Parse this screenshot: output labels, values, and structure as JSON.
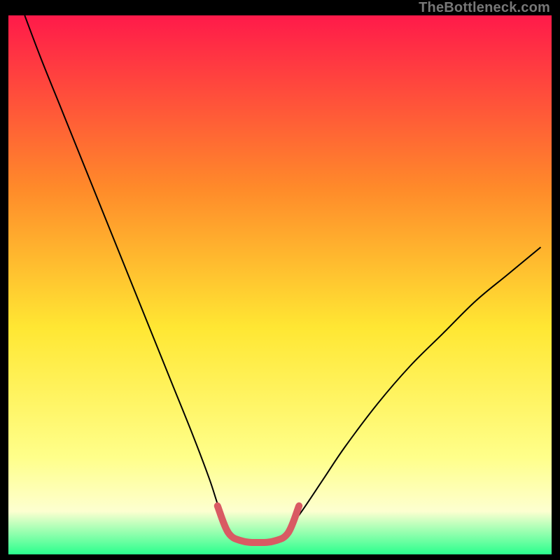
{
  "watermark": "TheBottleneck.com",
  "chart_data": {
    "type": "line",
    "title": "",
    "xlabel": "",
    "ylabel": "",
    "xlim": [
      0,
      100
    ],
    "ylim": [
      0,
      100
    ],
    "grid": false,
    "background_gradient": {
      "top": "#ff1a4a",
      "mid_upper": "#ff8a2a",
      "mid": "#ffe733",
      "mid_lower": "#ffff8a",
      "band_light": "#fdffd0",
      "bottom": "#2aff8d"
    },
    "series": [
      {
        "name": "bottleneck-curve",
        "color": "#000000",
        "stroke_width": 2,
        "points": [
          {
            "x": 3,
            "y": 100
          },
          {
            "x": 6,
            "y": 92
          },
          {
            "x": 10,
            "y": 82
          },
          {
            "x": 14,
            "y": 72
          },
          {
            "x": 18,
            "y": 62
          },
          {
            "x": 22,
            "y": 52
          },
          {
            "x": 26,
            "y": 42
          },
          {
            "x": 30,
            "y": 32
          },
          {
            "x": 34,
            "y": 22
          },
          {
            "x": 37,
            "y": 14
          },
          {
            "x": 39,
            "y": 8
          },
          {
            "x": 41,
            "y": 4
          },
          {
            "x": 43,
            "y": 2
          },
          {
            "x": 46,
            "y": 2
          },
          {
            "x": 49,
            "y": 2
          },
          {
            "x": 51,
            "y": 4
          },
          {
            "x": 54,
            "y": 8
          },
          {
            "x": 58,
            "y": 14
          },
          {
            "x": 62,
            "y": 20
          },
          {
            "x": 68,
            "y": 28
          },
          {
            "x": 74,
            "y": 35
          },
          {
            "x": 80,
            "y": 41
          },
          {
            "x": 86,
            "y": 47
          },
          {
            "x": 92,
            "y": 52
          },
          {
            "x": 98,
            "y": 57
          }
        ]
      },
      {
        "name": "optimal-zone",
        "color": "#d95a63",
        "stroke_width": 10,
        "linecap": "round",
        "points": [
          {
            "x": 38.5,
            "y": 9
          },
          {
            "x": 40.5,
            "y": 4
          },
          {
            "x": 43,
            "y": 2.5
          },
          {
            "x": 46,
            "y": 2.2
          },
          {
            "x": 49,
            "y": 2.5
          },
          {
            "x": 51.5,
            "y": 4
          },
          {
            "x": 53.5,
            "y": 9
          }
        ]
      }
    ]
  }
}
